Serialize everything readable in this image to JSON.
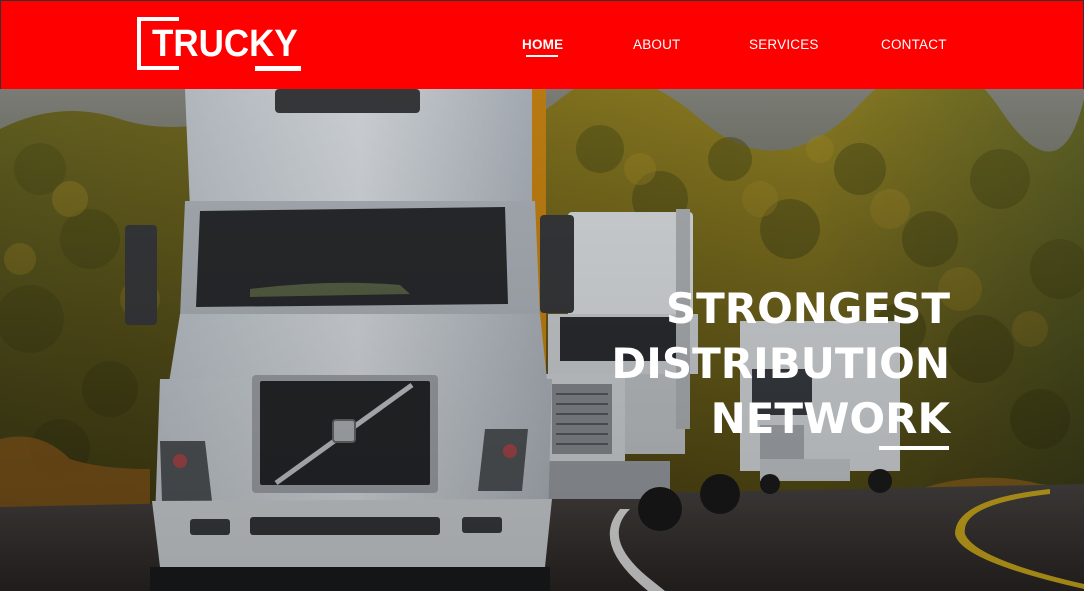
{
  "brand": {
    "logo_text": "TRUCKY"
  },
  "nav": {
    "items": [
      {
        "label": "HOME",
        "active": true
      },
      {
        "label": "ABOUT",
        "active": false
      },
      {
        "label": "SERVICES",
        "active": false
      },
      {
        "label": "CONTACT",
        "active": false
      }
    ]
  },
  "hero": {
    "title_lines": [
      "STRONGEST",
      "DISTRIBUTION",
      "NETWORK"
    ],
    "image_description": "white semi trucks driving on a road through a forest at sunset"
  },
  "colors": {
    "header_bg": "#ff0000",
    "text": "#ffffff"
  }
}
